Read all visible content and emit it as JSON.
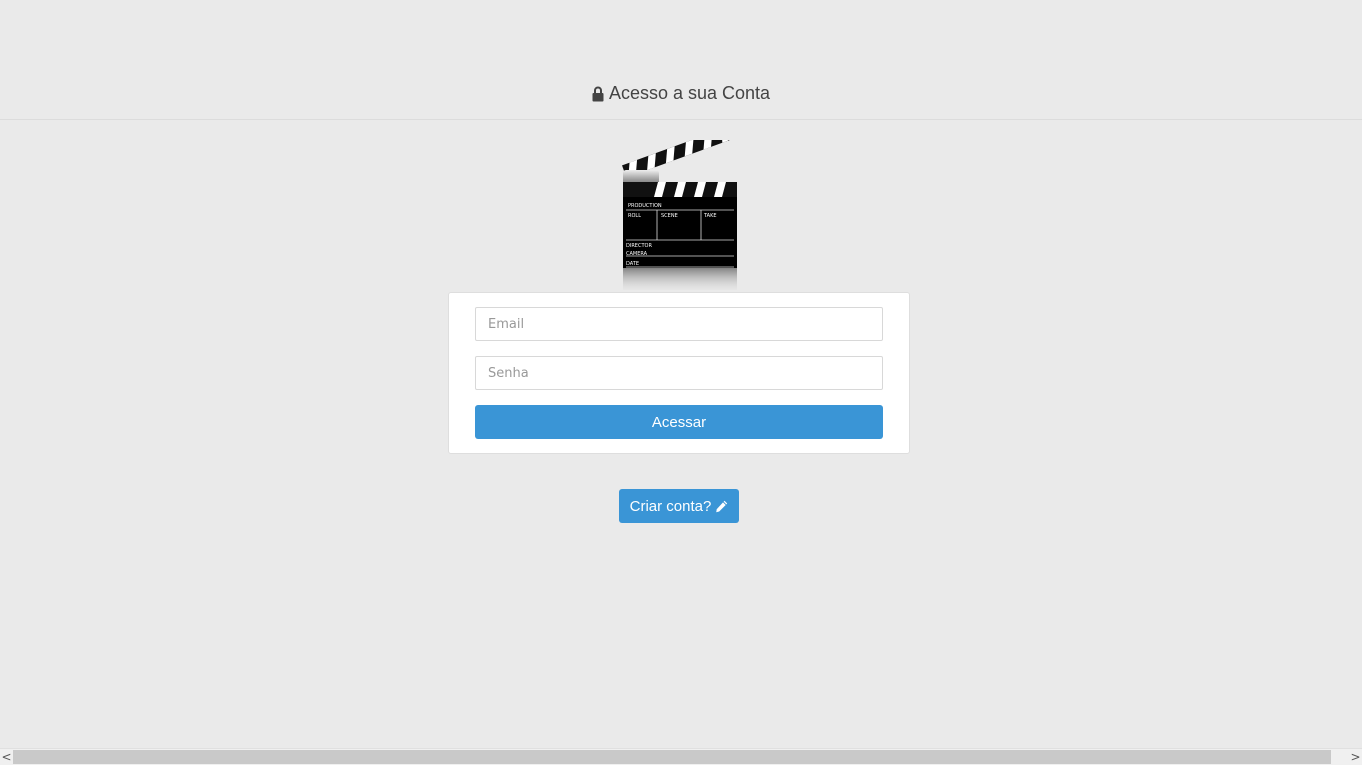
{
  "header": {
    "title": "Acesso a sua Conta",
    "icon": "lock-icon"
  },
  "logo": {
    "icon": "film-clapperboard-icon",
    "labels": {
      "production": "PRODUCTION",
      "roll": "ROLL",
      "scene": "SCENE",
      "take": "TAKE",
      "director": "DIRECTOR",
      "camera": "CAMERA",
      "date": "DATE"
    }
  },
  "login_form": {
    "email_placeholder": "Email",
    "email_value": "",
    "password_placeholder": "Senha",
    "password_value": "",
    "submit_label": "Acessar"
  },
  "create_account": {
    "label": "Criar conta?",
    "icon": "pencil-icon"
  },
  "scrollbar": {
    "left_arrow": "<",
    "right_arrow": ">"
  },
  "colors": {
    "background": "#eaeaea",
    "accent": "#3a95d6",
    "card": "#ffffff"
  }
}
